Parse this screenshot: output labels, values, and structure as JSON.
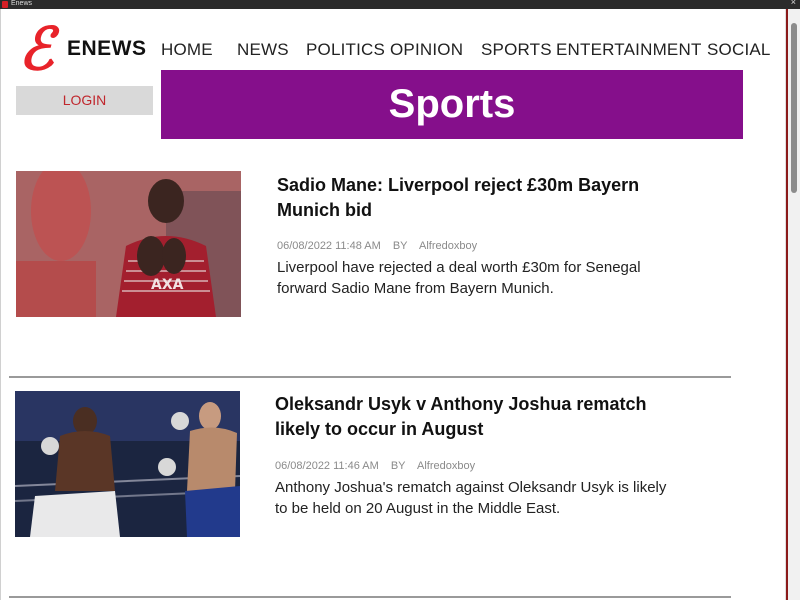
{
  "window": {
    "title": "Enews"
  },
  "brand": {
    "logo_glyph": "ℰ",
    "name": "ENEWS",
    "logo_color": "#e8232a"
  },
  "nav": {
    "items": [
      {
        "label": "HOME"
      },
      {
        "label": "NEWS"
      },
      {
        "label": "POLITICS"
      },
      {
        "label": "OPINION"
      },
      {
        "label": "SPORTS"
      },
      {
        "label": "ENTERTAINMENT"
      },
      {
        "label": "SOCIAL"
      }
    ]
  },
  "login": {
    "label": "LOGIN"
  },
  "banner": {
    "title": "Sports",
    "color": "#850f8b"
  },
  "articles": [
    {
      "headline": "Sadio Mane: Liverpool reject £30m Bayern Munich bid",
      "date": "06/08/2022 11:48 AM",
      "by_label": "BY",
      "author": "Alfredoxboy",
      "summary": "Liverpool have rejected a deal worth £30m for Senegal forward Sadio Mane from Bayern Munich."
    },
    {
      "headline": "Oleksandr Usyk v Anthony Joshua rematch likely to occur in August",
      "date": "06/08/2022 11:46 AM",
      "by_label": "BY",
      "author": "Alfredoxboy",
      "summary": "Anthony Joshua's rematch against Oleksandr Usyk is likely to be held on 20 August in the Middle East."
    }
  ]
}
